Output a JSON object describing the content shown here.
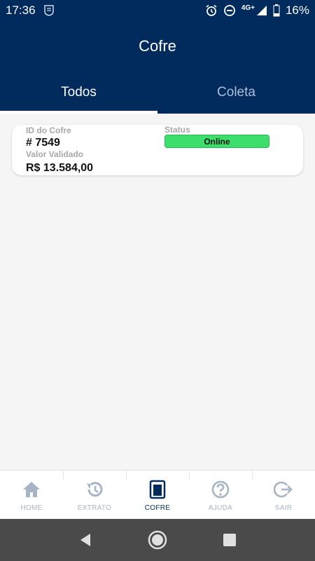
{
  "status_bar": {
    "time": "17:36",
    "battery": "16%",
    "network": "4G+"
  },
  "app_bar": {
    "title": "Cofre"
  },
  "tabs": [
    {
      "label": "Todos",
      "active": true
    },
    {
      "label": "Coleta",
      "active": false
    }
  ],
  "card": {
    "id_label": "ID do Cofre",
    "id_value": "# 7549",
    "status_label": "Status",
    "status_value": "Online",
    "valor_label": "Valor Validado",
    "valor_value": "R$ 13.584,00"
  },
  "bottom_nav": [
    {
      "label": "HOME",
      "icon": "home-icon",
      "active": false
    },
    {
      "label": "EXTRATO",
      "icon": "history-icon",
      "active": false
    },
    {
      "label": "COFRE",
      "icon": "safe-icon",
      "active": true
    },
    {
      "label": "AJUDA",
      "icon": "help-icon",
      "active": false
    },
    {
      "label": "SAIR",
      "icon": "logout-icon",
      "active": false
    }
  ],
  "colors": {
    "primary": "#002b5c",
    "status_online": "#3dde6b",
    "nav_inactive": "#a7b4c6"
  }
}
